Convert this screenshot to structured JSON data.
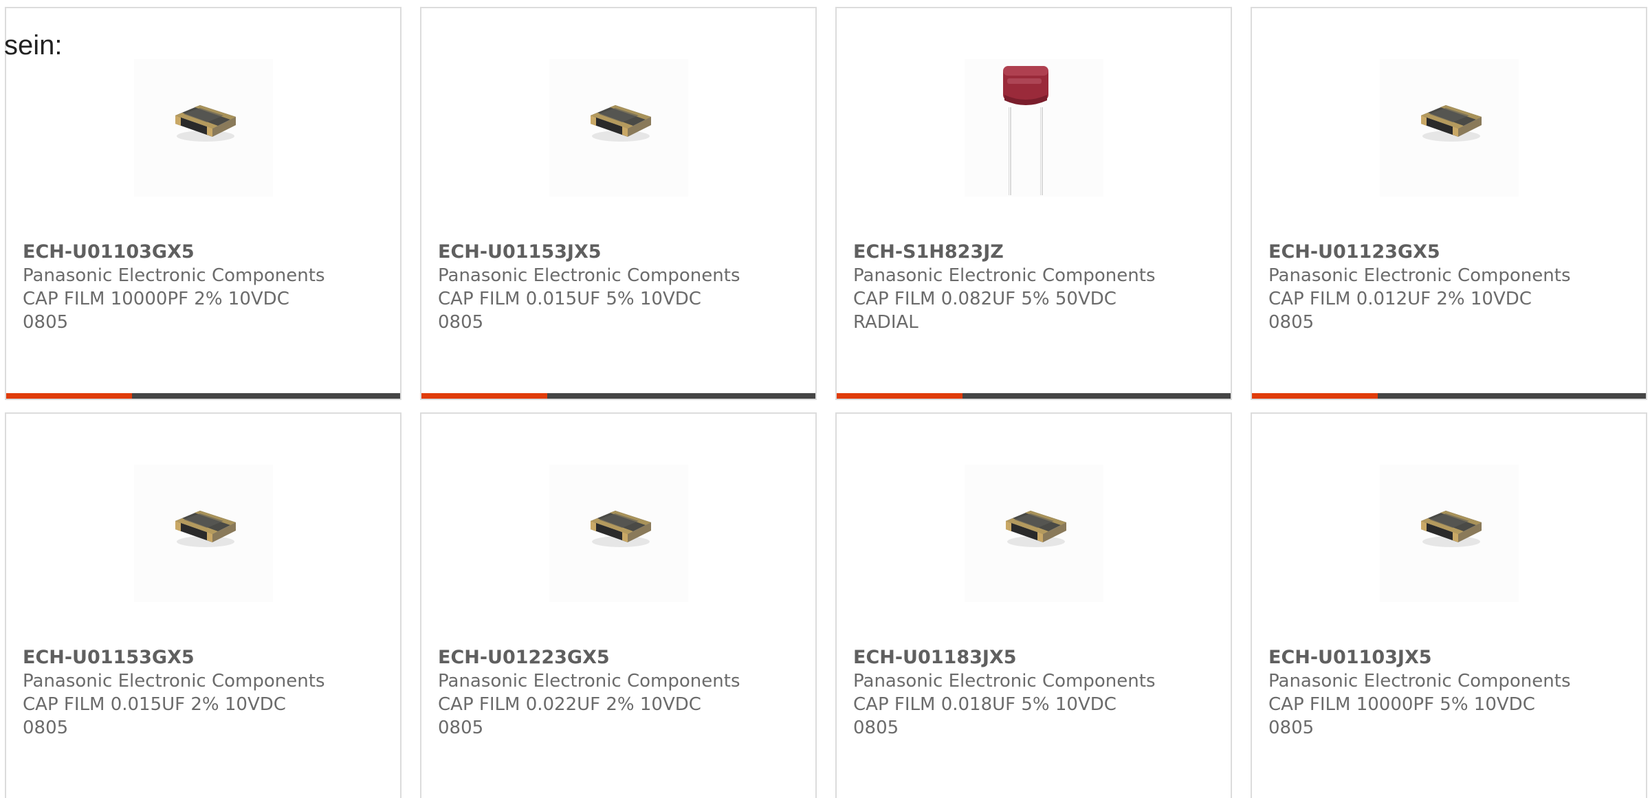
{
  "intro_text": "sein:",
  "colors": {
    "accent": "#e03c0a",
    "bar": "#454545",
    "border": "#dcdcdc",
    "text": "#6b6b6b"
  },
  "products": [
    {
      "part_number": "ECH-U01103GX5",
      "manufacturer": "Panasonic Electronic Components",
      "description": "CAP FILM 10000PF 2% 10VDC",
      "package": "0805",
      "image": "smd-film-capacitor-icon"
    },
    {
      "part_number": "ECH-U01153JX5",
      "manufacturer": "Panasonic Electronic Components",
      "description": "CAP FILM 0.015UF 5% 10VDC",
      "package": "0805",
      "image": "smd-film-capacitor-icon"
    },
    {
      "part_number": "ECH-S1H823JZ",
      "manufacturer": "Panasonic Electronic Components",
      "description": "CAP FILM 0.082UF 5% 50VDC",
      "package": "RADIAL",
      "image": "radial-film-capacitor-icon"
    },
    {
      "part_number": "ECH-U01123GX5",
      "manufacturer": "Panasonic Electronic Components",
      "description": "CAP FILM 0.012UF 2% 10VDC",
      "package": "0805",
      "image": "smd-film-capacitor-icon"
    },
    {
      "part_number": "ECH-U01153GX5",
      "manufacturer": "Panasonic Electronic Components",
      "description": "CAP FILM 0.015UF 2% 10VDC",
      "package": "0805",
      "image": "smd-film-capacitor-icon"
    },
    {
      "part_number": "ECH-U01223GX5",
      "manufacturer": "Panasonic Electronic Components",
      "description": "CAP FILM 0.022UF 2% 10VDC",
      "package": "0805",
      "image": "smd-film-capacitor-icon"
    },
    {
      "part_number": "ECH-U01183JX5",
      "manufacturer": "Panasonic Electronic Components",
      "description": "CAP FILM 0.018UF 5% 10VDC",
      "package": "0805",
      "image": "smd-film-capacitor-icon"
    },
    {
      "part_number": "ECH-U01103JX5",
      "manufacturer": "Panasonic Electronic Components",
      "description": "CAP FILM 10000PF 5% 10VDC",
      "package": "0805",
      "image": "smd-film-capacitor-icon"
    }
  ]
}
